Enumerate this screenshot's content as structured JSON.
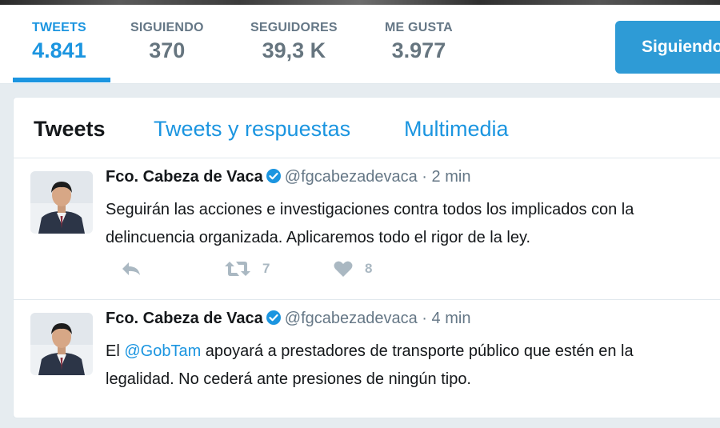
{
  "profile_nav": {
    "stats": [
      {
        "label": "TWEETS",
        "value": "4.841"
      },
      {
        "label": "SIGUIENDO",
        "value": "370"
      },
      {
        "label": "SEGUIDORES",
        "value": "39,3 K"
      },
      {
        "label": "ME GUSTA",
        "value": "3.977"
      }
    ],
    "follow_button": "Siguiendo"
  },
  "timeline": {
    "tabs": [
      {
        "label": "Tweets"
      },
      {
        "label": "Tweets y respuestas"
      },
      {
        "label": "Multimedia"
      }
    ],
    "tweets": [
      {
        "name": "Fco. Cabeza de Vaca",
        "handle": "@fgcabezadevaca",
        "separator": "·",
        "time": "2 min",
        "text_line1": "Seguirán las acciones e investigaciones contra todos los implicados con la",
        "text_line2": "delincuencia organizada. Aplicaremos todo el rigor de la ley.",
        "retweets": "7",
        "likes": "8"
      },
      {
        "name": "Fco. Cabeza de Vaca",
        "handle": "@fgcabezadevaca",
        "separator": "·",
        "time": "4 min",
        "text_prefix": "El ",
        "mention": "@GobTam",
        "text_rest": " apoyará a prestadores de transporte público que estén en la",
        "text_line2": "legalidad. No cederá ante presiones de ningún tipo."
      }
    ]
  },
  "colors": {
    "accent": "#1b95e0",
    "follow_button": "#2e9bd6",
    "muted": "#657786",
    "action_icons": "#aab8c2"
  },
  "icons": [
    "verified-badge-icon",
    "reply-icon",
    "retweet-icon",
    "like-heart-icon"
  ]
}
